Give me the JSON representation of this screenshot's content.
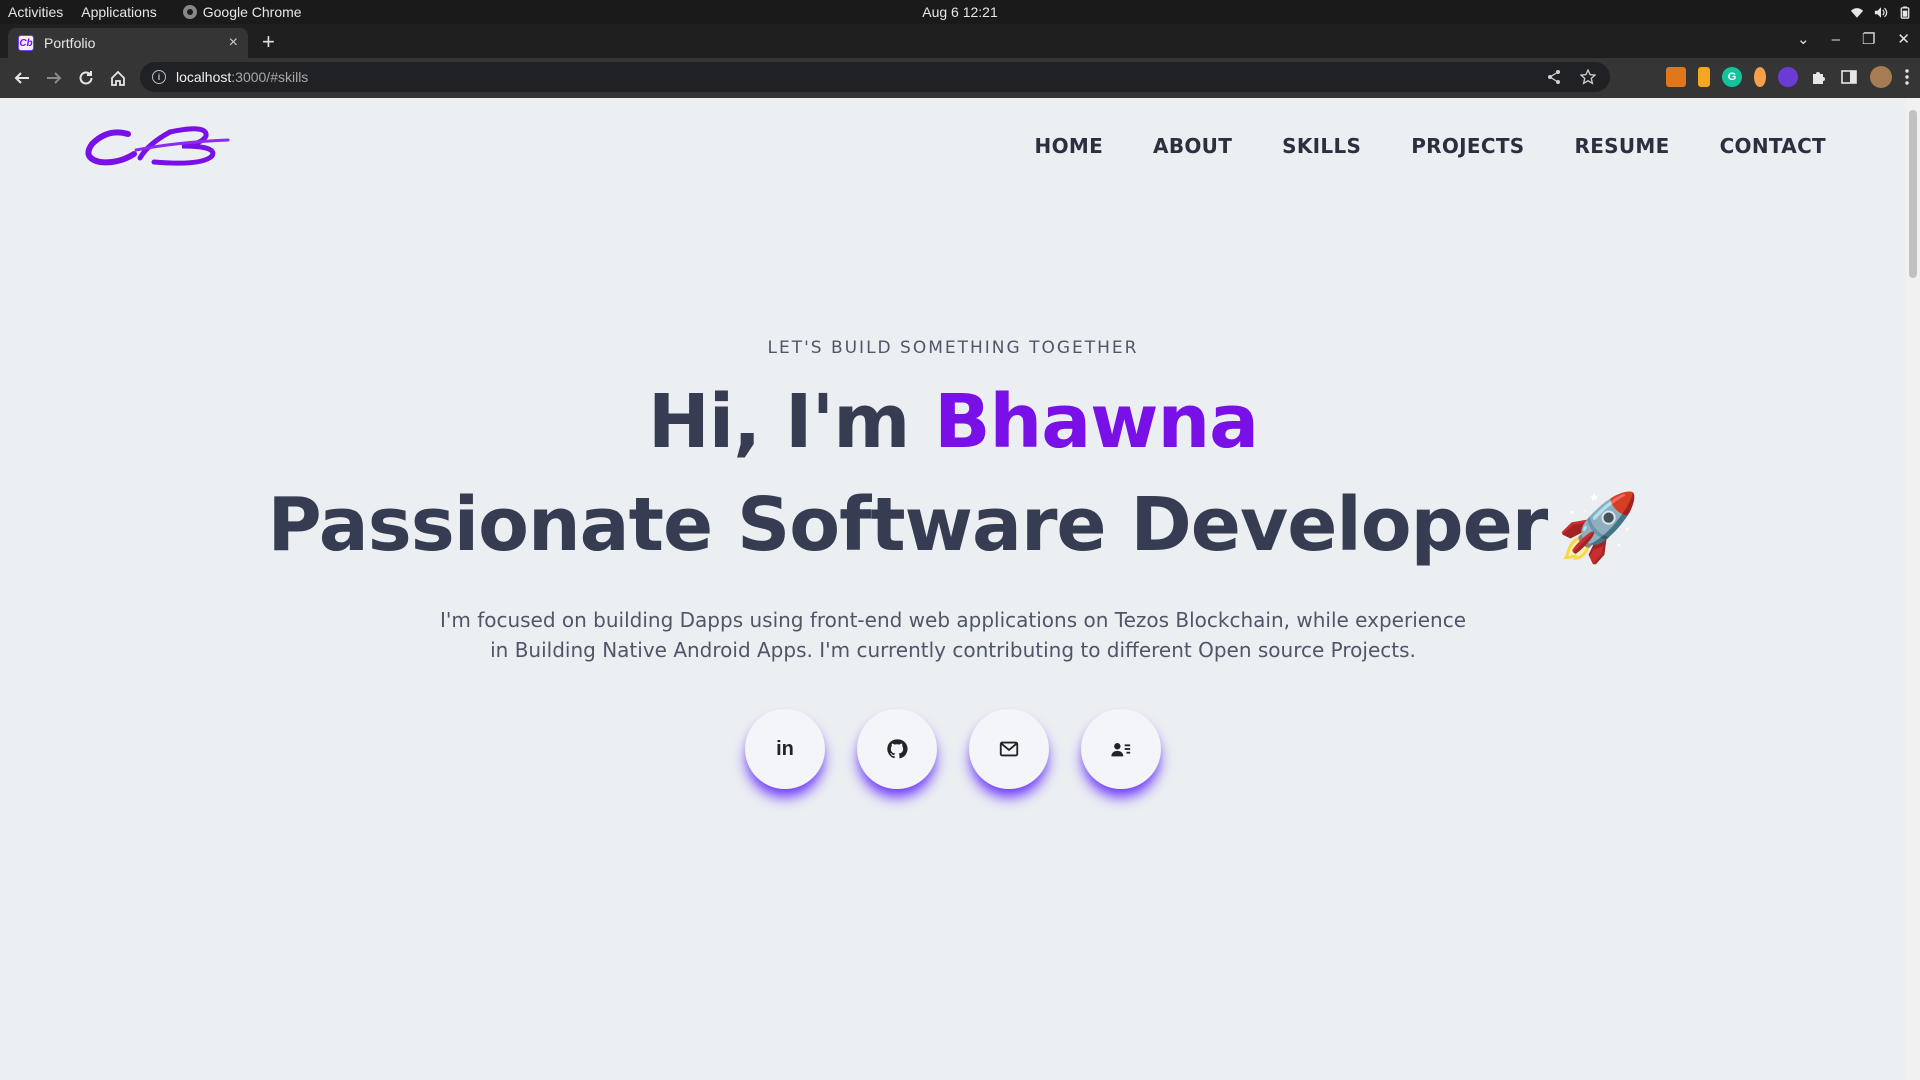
{
  "os_bar": {
    "activities": "Activities",
    "applications": "Applications",
    "app_name": "Google Chrome",
    "clock": "Aug 6  12:21"
  },
  "browser": {
    "tab_title": "Portfolio",
    "tab_close": "×",
    "new_tab": "+",
    "url_host": "localhost",
    "url_rest": ":3000/#skills",
    "window_controls": [
      "⌄",
      "–",
      "❐",
      "✕"
    ]
  },
  "site": {
    "logo_text": "CB",
    "nav": [
      "HOME",
      "ABOUT",
      "SKILLS",
      "PROJECTS",
      "RESUME",
      "CONTACT"
    ],
    "eyebrow": "LET'S BUILD SOMETHING TOGETHER",
    "greeting": "Hi, I'm ",
    "name": "Bhawna",
    "role": "Passionate Software Developer",
    "rocket": "🚀",
    "intro": "I'm focused on building Dapps using front-end web applications on Tezos Blockchain, while experience in Building Native Android Apps. I'm currently contributing to different Open source Projects.",
    "socials": [
      {
        "icon": "linkedin-icon",
        "label": "in"
      },
      {
        "icon": "github-icon"
      },
      {
        "icon": "mail-icon"
      },
      {
        "icon": "contact-card-icon"
      }
    ],
    "accent_color": "#7a10e8",
    "text_color": "#363c52",
    "bg_color": "#ebeff2"
  }
}
